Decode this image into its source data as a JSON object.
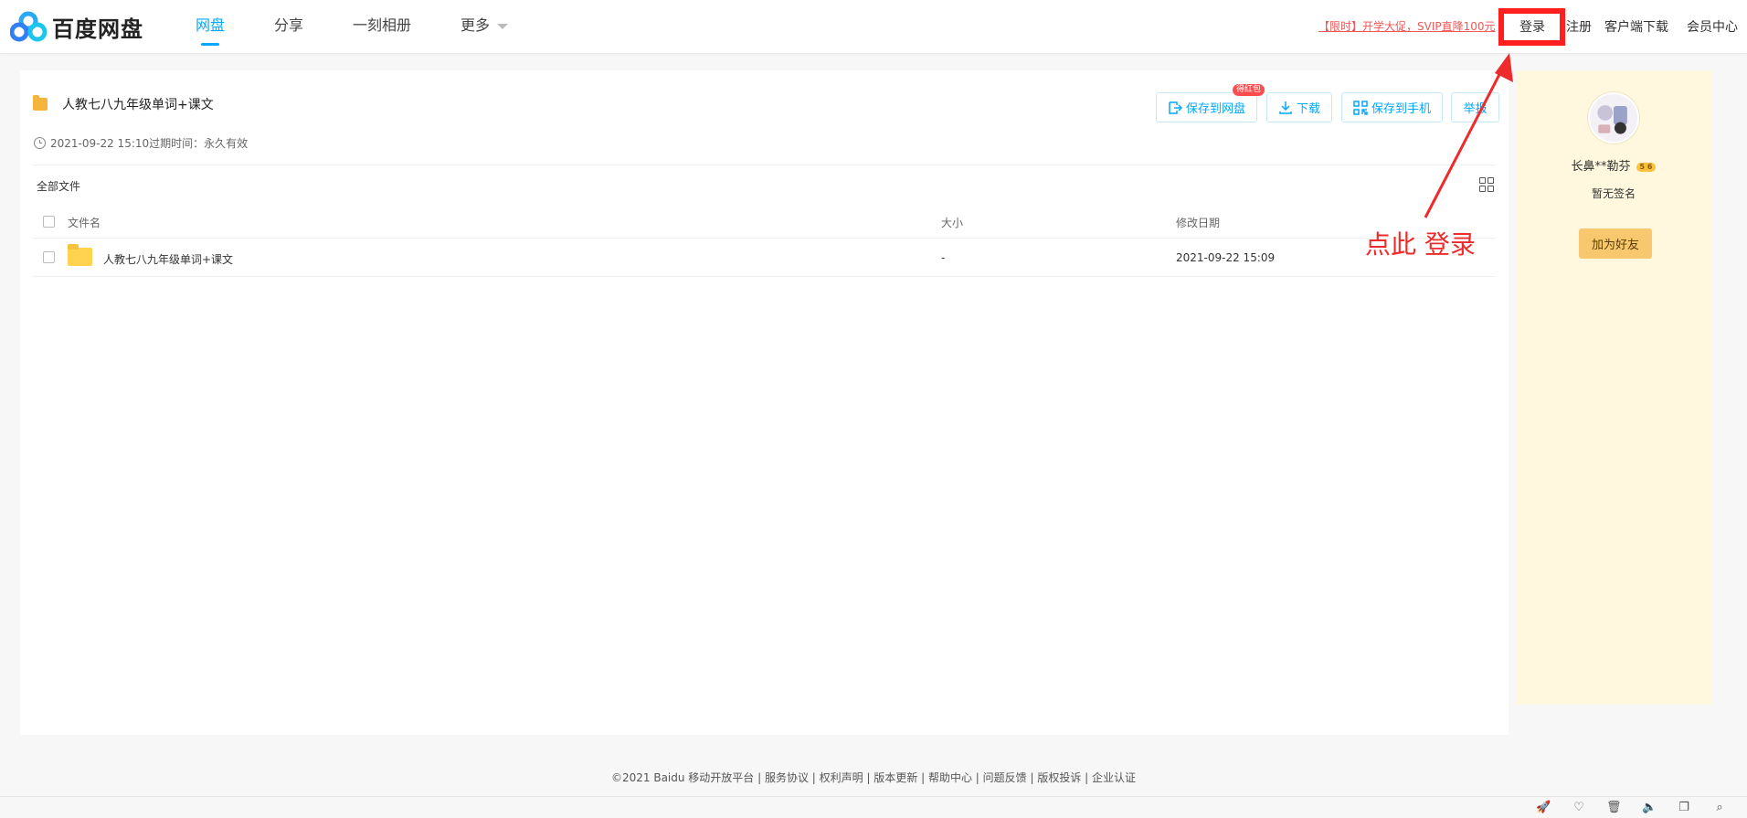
{
  "header": {
    "logo_text": "百度网盘",
    "nav": [
      "网盘",
      "分享",
      "一刻相册",
      "更多"
    ],
    "promo": "【限时】开学大促，SVIP直降100元",
    "login": "登录",
    "register": "注册",
    "client_download": "客户端下载",
    "vip_center": "会员中心"
  },
  "share": {
    "title": "人教七八九年级单词+课文",
    "meta": "2021-09-22 15:10过期时间：永久有效",
    "buttons": {
      "save_to_disk": "保存到网盘",
      "save_badge": "得红包",
      "download": "下载",
      "save_to_phone": "保存到手机",
      "report": "举报"
    },
    "breadcrumb": "全部文件",
    "columns": {
      "name": "文件名",
      "size": "大小",
      "modified": "修改日期"
    },
    "files": [
      {
        "name": "人教七八九年级单词+课文",
        "size": "-",
        "modified": "2021-09-22 15:09"
      }
    ]
  },
  "sidebar": {
    "username": "长鼻**勒芬",
    "level": "5 6",
    "signature": "暂无签名",
    "add_friend": "加为好友"
  },
  "annotation": {
    "text": "点此 登录",
    "color": "#ee2b2b"
  },
  "footer": {
    "text": "©2021 Baidu  移动开放平台 | 服务协议 | 权利声明 | 版本更新 | 帮助中心 | 问题反馈 | 版权投诉 | 企业认证"
  },
  "statusbar": {
    "icons": [
      "rocket-icon",
      "heart-icon",
      "trash-icon",
      "speaker-icon",
      "window-icon",
      "search-icon"
    ]
  },
  "colors": {
    "accent": "#06a7ff",
    "promo": "#f25757",
    "highlight_box": "#ff1f1f",
    "sidebar_bg": "#fff8de"
  }
}
